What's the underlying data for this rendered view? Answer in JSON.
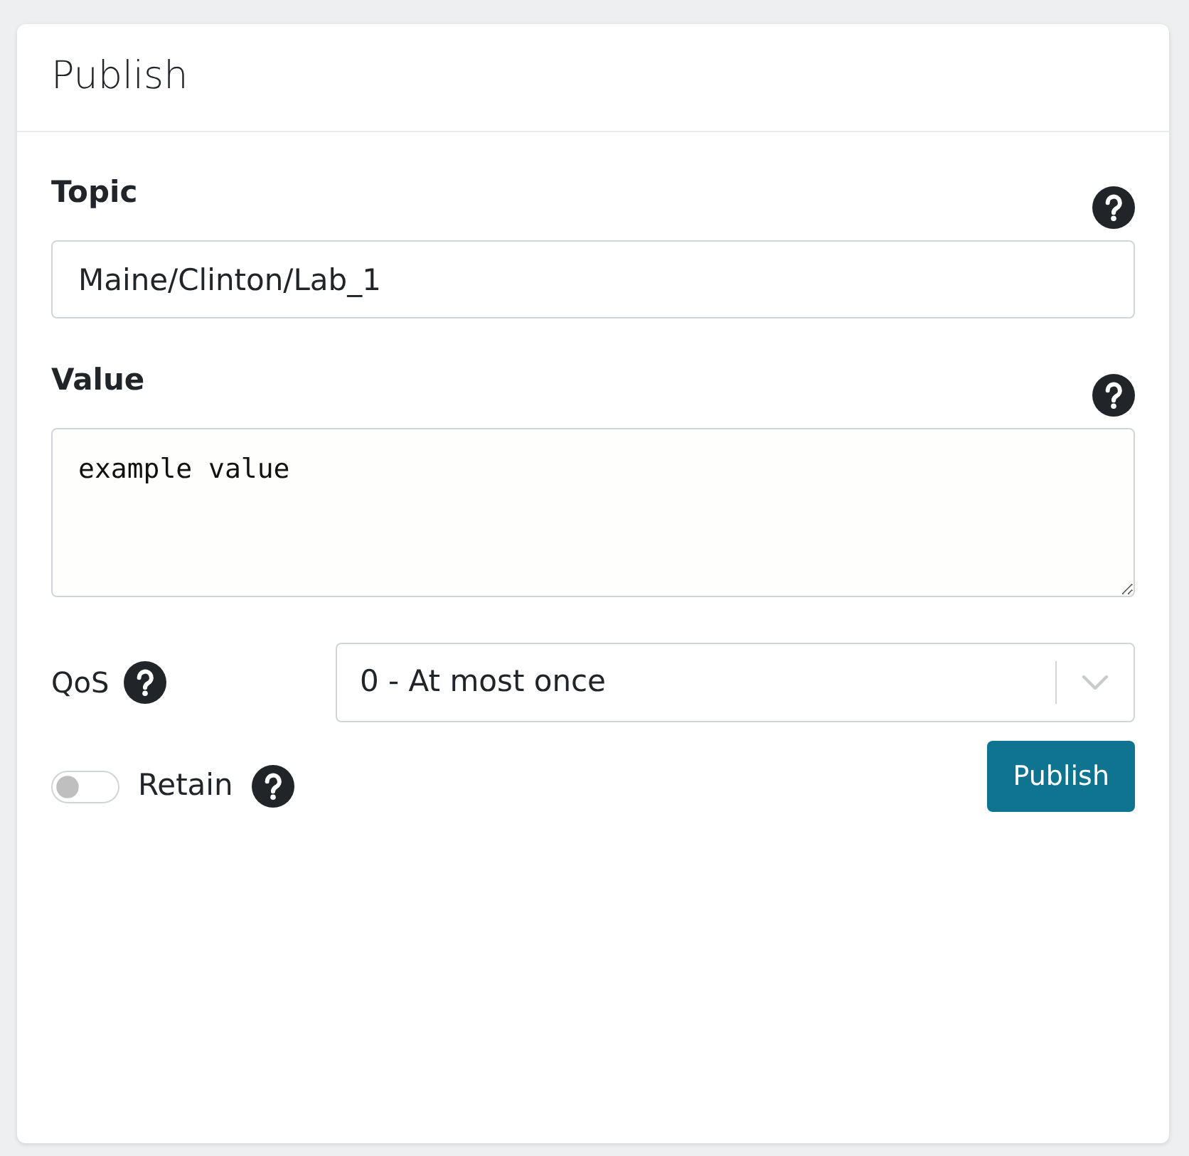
{
  "card": {
    "title": "Publish"
  },
  "topic": {
    "label": "Topic",
    "value": "Maine/Clinton/Lab_1"
  },
  "value": {
    "label": "Value",
    "value": "example value"
  },
  "qos": {
    "label": "QoS",
    "value": "0 - At most once"
  },
  "retain": {
    "label": "Retain",
    "on": false
  },
  "publish_button": {
    "label": "Publish"
  }
}
